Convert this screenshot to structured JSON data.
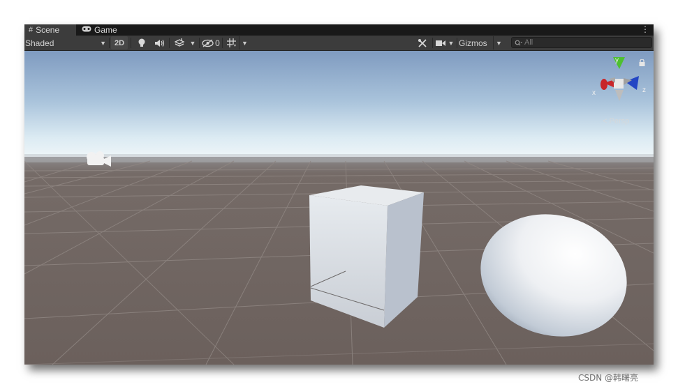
{
  "tabs": [
    {
      "label": "Scene",
      "icon": "grid-icon",
      "active": true
    },
    {
      "label": "Game",
      "icon": "gamepad-icon",
      "active": false
    }
  ],
  "toolbar": {
    "draw_mode": "Shaded",
    "mode_2d": "2D",
    "hidden_count": "0",
    "gizmos_label": "Gizmos",
    "search_placeholder": "All"
  },
  "viewport": {
    "projection_label": "Persp",
    "orientation_gizmo": {
      "x_label": "x",
      "y_label": "y",
      "z_label": "z"
    },
    "colors": {
      "sky_top": "#7f9bc0",
      "horizon": "#eef5f8",
      "ground": "#6d625e",
      "x_axis": "#c8262a",
      "y_axis": "#4ec030",
      "z_axis": "#2446c4"
    }
  },
  "watermark": "CSDN @韩曙亮"
}
